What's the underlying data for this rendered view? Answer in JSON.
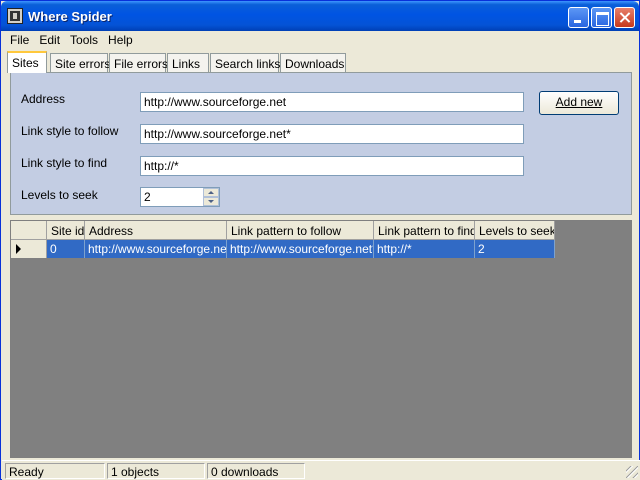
{
  "window": {
    "title": "Where Spider"
  },
  "menu": [
    "File",
    "Edit",
    "Tools",
    "Help"
  ],
  "tabs": [
    "Sites",
    "Site errors",
    "File errors",
    "Links",
    "Search links",
    "Downloads"
  ],
  "active_tab": "Sites",
  "form": {
    "address_label": "Address",
    "address_value": "http://www.sourceforge.net",
    "follow_label": "Link style to follow",
    "follow_value": "http://www.sourceforge.net*",
    "find_label": "Link style to find",
    "find_value": "http://*",
    "levels_label": "Levels to seek",
    "levels_value": "2",
    "add_button": "Add new"
  },
  "grid": {
    "columns": [
      "Site id",
      "Address",
      "Link pattern to follow",
      "Link pattern to find",
      "Levels to seek"
    ],
    "rows": [
      [
        "0",
        "http://www.sourceforge.net",
        "http://www.sourceforge.net*",
        "http://*",
        "2"
      ]
    ]
  },
  "status": {
    "state": "Ready",
    "objects": "1 objects",
    "downloads": "0 downloads"
  },
  "colors": {
    "title_bar": "#0054e3",
    "panel_bg": "#c3cde3",
    "grid_bg": "#808080",
    "selection": "#316ac5"
  }
}
